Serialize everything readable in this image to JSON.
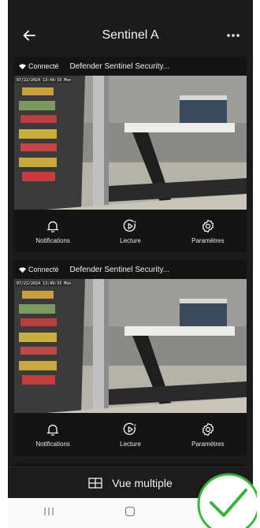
{
  "header": {
    "title": "Sentinel A",
    "back_icon": "arrow-left-icon",
    "more_icon": "more-horizontal-icon"
  },
  "cameras": [
    {
      "status": "Connecté",
      "name": "Defender Sentinel Security...",
      "timestamp": "07/22/2024  13:49:33  Mon",
      "actions": {
        "notifications": "Notifications",
        "playback": "Lecture",
        "settings": "Paramètres"
      }
    },
    {
      "status": "Connecté",
      "name": "Defender Sentinel Security...",
      "timestamp": "07/22/2024  13:49:33  Mon",
      "actions": {
        "notifications": "Notifications",
        "playback": "Lecture",
        "settings": "Paramètres"
      }
    }
  ],
  "bottom_bar": {
    "label": "Vue multiple",
    "icon": "grid-icon"
  },
  "colors": {
    "background": "#1b1b1b",
    "card": "#141414",
    "check": "#3db33d"
  }
}
